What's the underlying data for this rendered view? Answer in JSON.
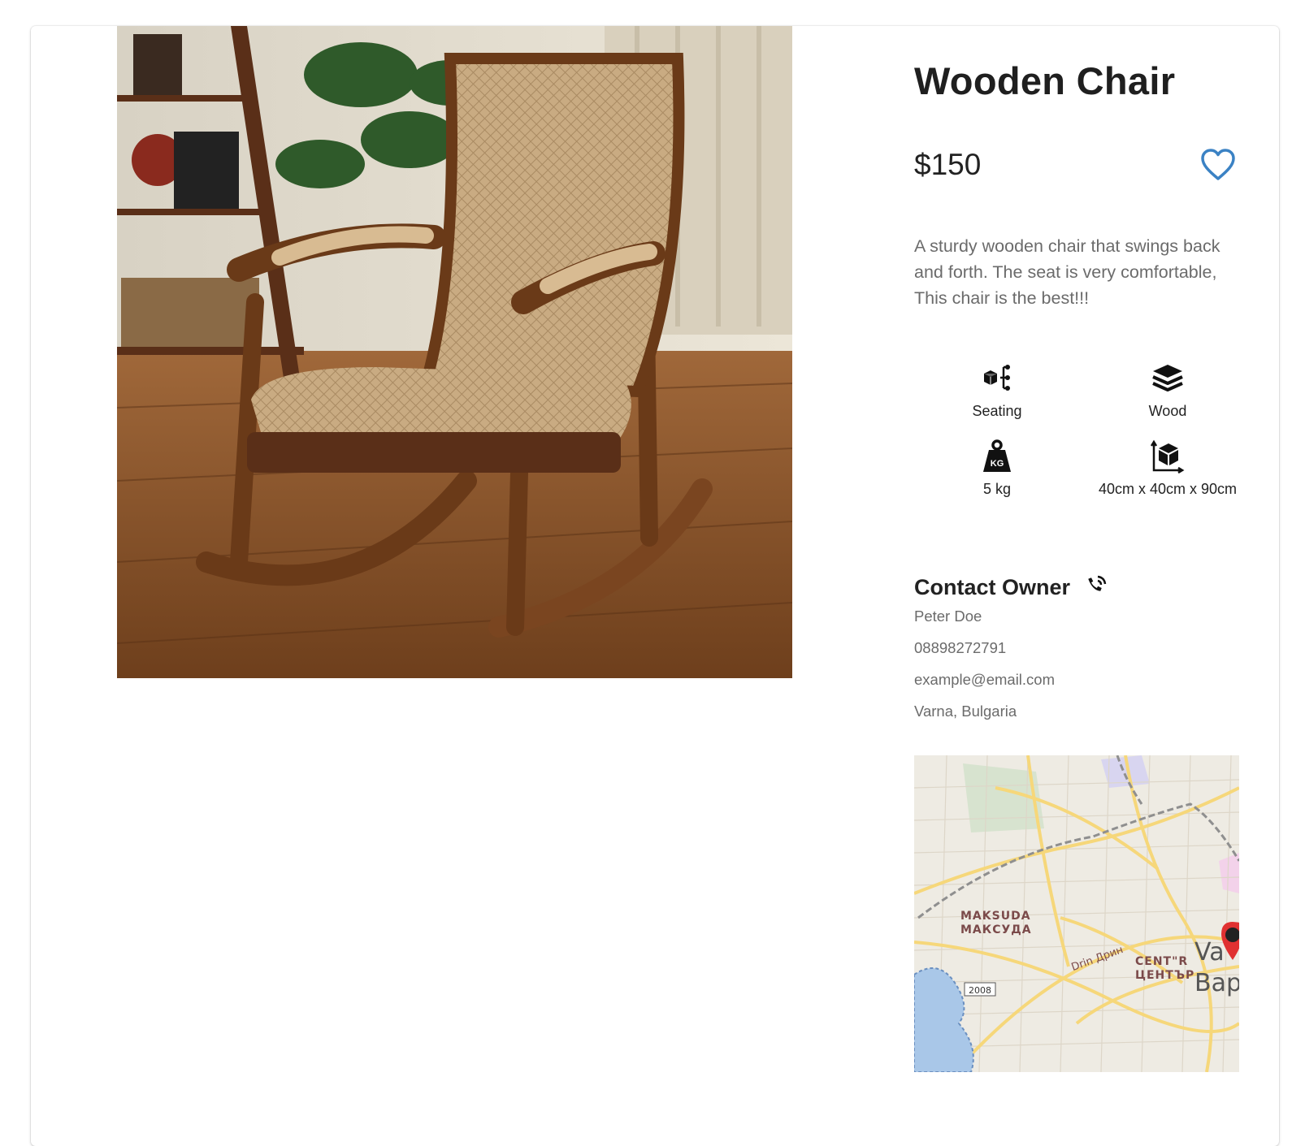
{
  "product": {
    "title": "Wooden Chair",
    "price": "$150",
    "description": "A sturdy wooden chair that swings back and forth. The seat is very comfortable, This chair is the best!!!",
    "image_alt": "Rocking chair with beige diamond-pattern upholstery"
  },
  "specs": [
    {
      "icon": "category-icon",
      "label": "Seating"
    },
    {
      "icon": "layers-icon",
      "label": "Wood"
    },
    {
      "icon": "weight-icon",
      "label": "5 kg"
    },
    {
      "icon": "dimensions-icon",
      "label": "40cm x 40cm x 90cm"
    }
  ],
  "weight_icon_text": "KG",
  "contact": {
    "title": "Contact Owner",
    "icon": "phone-ringing-icon",
    "name": "Peter Doe",
    "phone": "08898272791",
    "email": "example@email.com",
    "location": "Varna, Bulgaria"
  },
  "map": {
    "labels": {
      "district1_latin": "MAKSUDA",
      "district1_cyrillic": "МАКСУДА",
      "road": "Drin Дрин",
      "district2_latin": "CENT\"R",
      "district2_cyrillic": "ЦЕНТЪР",
      "city_latin_partial": "Va",
      "city_cyrillic_partial": "Вар",
      "road_number": "2008"
    }
  },
  "colors": {
    "accent": "#3b82c4",
    "text_muted": "#6b6b6b",
    "title": "#1f1f1f"
  }
}
